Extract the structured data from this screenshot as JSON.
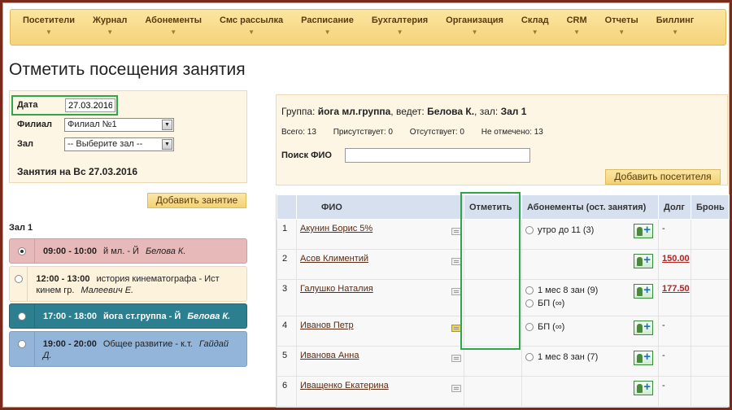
{
  "menu": [
    {
      "label": "Посетители"
    },
    {
      "label": "Журнал"
    },
    {
      "label": "Абонементы"
    },
    {
      "label": "Смс рассылка"
    },
    {
      "label": "Расписание"
    },
    {
      "label": "Бухгалтерия"
    },
    {
      "label": "Организация"
    },
    {
      "label": "Склад"
    },
    {
      "label": "CRM"
    },
    {
      "label": "Отчеты"
    },
    {
      "label": "Биллинг"
    }
  ],
  "page_title": "Отметить посещения занятия",
  "filter": {
    "date_label": "Дата",
    "date_value": "27.03.2016",
    "branch_label": "Филиал",
    "branch_value": "Филиал №1",
    "hall_label": "Зал",
    "hall_value": "-- Выберите зал --",
    "sessions_title": "Занятия на Вс 27.03.2016",
    "add_session_button": "Добавить занятие"
  },
  "hall_name": "Зал 1",
  "sessions": [
    {
      "time": "09:00 - 10:00",
      "title": "й мл. - Й",
      "teacher": "Белова К.",
      "selected": true
    },
    {
      "time": "12:00 - 13:00",
      "title": "история кинематографа - Ист кинем гр.",
      "teacher": "Малеевич Е.",
      "selected": false
    },
    {
      "time": "17:00 - 18:00",
      "title": "йога ст.группа - Й",
      "teacher": "Белова К.",
      "selected": false
    },
    {
      "time": "19:00 - 20:00",
      "title": "Общее развитие - к.т.",
      "teacher": "Гайдай Д.",
      "selected": false
    }
  ],
  "info": {
    "group_prefix": "Группа:",
    "group_name": "йога мл.группа",
    "lead_prefix": ", ведет:",
    "teacher": "Белова К.",
    "hall_prefix": ", зал:",
    "hall": "Зал 1",
    "total": "Всего: 13",
    "present": "Присутствует: 0",
    "absent": "Отсутствует: 0",
    "unmarked": "Не отмечено: 13",
    "search_label": "Поиск ФИО",
    "search_value": "",
    "add_visitor_button": "Добавить посетителя"
  },
  "table": {
    "headers": [
      "",
      "ФИО",
      "Отметить",
      "Абонементы (ост. занятия)",
      "Долг",
      "Бронь"
    ],
    "rows": [
      {
        "n": "1",
        "name": "Акунин Борис 5%",
        "note_active": false,
        "abos": [
          "утро до 11 (3)"
        ],
        "debt": "-",
        "debt_link": false
      },
      {
        "n": "2",
        "name": "Асов Климентий",
        "note_active": false,
        "abos": [],
        "debt": "150.00",
        "debt_link": true
      },
      {
        "n": "3",
        "name": "Галушко Наталия",
        "note_active": false,
        "abos": [
          "1 мес 8 зан (9)",
          "БП (∞)"
        ],
        "debt": "177.50",
        "debt_link": true
      },
      {
        "n": "4",
        "name": "Иванов Петр",
        "note_active": true,
        "abos": [
          "БП (∞)"
        ],
        "debt": "-",
        "debt_link": false
      },
      {
        "n": "5",
        "name": "Иванова Анна",
        "note_active": false,
        "abos": [
          "1 мес 8 зан (7)"
        ],
        "debt": "-",
        "debt_link": false
      },
      {
        "n": "6",
        "name": "Иващенко Екатерина",
        "note_active": false,
        "abos": [],
        "debt": "-",
        "debt_link": false
      }
    ]
  }
}
